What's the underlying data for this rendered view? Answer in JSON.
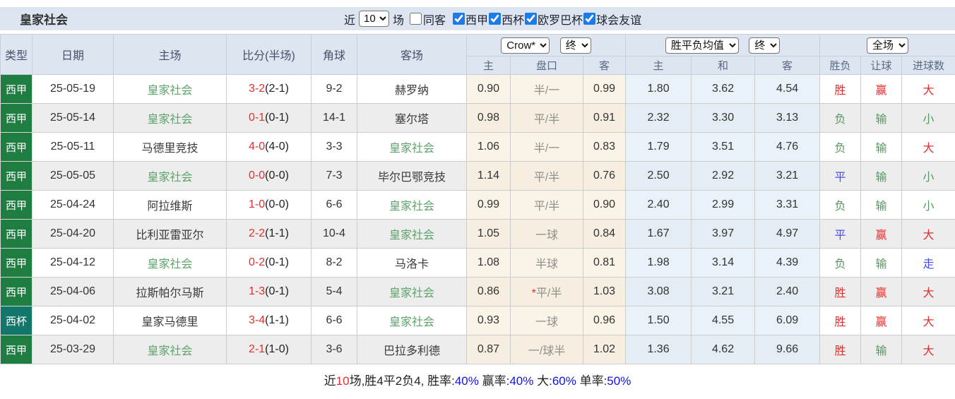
{
  "title": "皇家社会",
  "controls": {
    "recent_label": "近",
    "recent_count": "10",
    "matches_label": "场",
    "same_away": {
      "label": "同客",
      "checked": false
    },
    "filters": [
      {
        "label": "西甲",
        "checked": true
      },
      {
        "label": "西杯",
        "checked": true
      },
      {
        "label": "欧罗巴杯",
        "checked": true
      },
      {
        "label": "球会友谊",
        "checked": true
      }
    ]
  },
  "colors": {
    "league_badge_green": "#1f7d41",
    "cup_badge_teal": "#13766b",
    "team_highlight_green": "#5ea36c",
    "team_dark": "#3a3a3a",
    "result_red": "#e62e2e",
    "result_green": "#559a60",
    "result_blue": "#4a4af5",
    "header_bg": "#dce5f0"
  },
  "table": {
    "columns": [
      "类型",
      "日期",
      "主场",
      "比分(半场)",
      "角球",
      "客场"
    ],
    "odds_columns": [
      "主",
      "盘口",
      "客",
      "主",
      "和",
      "客",
      "胜负",
      "让球",
      "进球数"
    ],
    "selects": {
      "ah_company": "Crow*",
      "ah_time": "终",
      "eu_company": "胜平负均值",
      "eu_time": "终",
      "scope": "全场"
    },
    "rows": [
      {
        "type": "西甲",
        "type_bg": "#1f7d41",
        "date": "25-05-19",
        "home": "皇家社会",
        "home_color": "#5ea36c",
        "score": "3-2",
        "half": "(2-1)",
        "corner": "9-2",
        "away": "赫罗纳",
        "away_color": "#3a3a3a",
        "ah_home": "0.90",
        "ah_star": "",
        "ah_line": "半/一",
        "ah_away": "0.99",
        "eu_home": "1.80",
        "eu_draw": "3.62",
        "eu_away": "4.54",
        "wdl": "胜",
        "wdl_color": "#e62e2e",
        "ah_result": "赢",
        "ah_result_color": "#e62e2e",
        "ou": "大",
        "ou_color": "#e62e2e"
      },
      {
        "type": "西甲",
        "type_bg": "#1f7d41",
        "date": "25-05-14",
        "home": "皇家社会",
        "home_color": "#5ea36c",
        "score": "0-1",
        "half": "(0-1)",
        "corner": "14-1",
        "away": "塞尔塔",
        "away_color": "#3a3a3a",
        "ah_home": "0.98",
        "ah_star": "",
        "ah_line": "平/半",
        "ah_away": "0.91",
        "eu_home": "2.32",
        "eu_draw": "3.30",
        "eu_away": "3.13",
        "wdl": "负",
        "wdl_color": "#559a60",
        "ah_result": "输",
        "ah_result_color": "#559a60",
        "ou": "小",
        "ou_color": "#559a60"
      },
      {
        "type": "西甲",
        "type_bg": "#1f7d41",
        "date": "25-05-11",
        "home": "马德里竞技",
        "home_color": "#3a3a3a",
        "score": "4-0",
        "half": "(4-0)",
        "corner": "3-3",
        "away": "皇家社会",
        "away_color": "#5ea36c",
        "ah_home": "1.06",
        "ah_star": "",
        "ah_line": "半/一",
        "ah_away": "0.83",
        "eu_home": "1.79",
        "eu_draw": "3.51",
        "eu_away": "4.76",
        "wdl": "负",
        "wdl_color": "#559a60",
        "ah_result": "输",
        "ah_result_color": "#559a60",
        "ou": "大",
        "ou_color": "#e62e2e"
      },
      {
        "type": "西甲",
        "type_bg": "#1f7d41",
        "date": "25-05-05",
        "home": "皇家社会",
        "home_color": "#5ea36c",
        "score": "0-0",
        "half": "(0-0)",
        "corner": "7-3",
        "away": "毕尔巴鄂竞技",
        "away_color": "#3a3a3a",
        "ah_home": "1.14",
        "ah_star": "",
        "ah_line": "平/半",
        "ah_away": "0.76",
        "eu_home": "2.50",
        "eu_draw": "2.92",
        "eu_away": "3.21",
        "wdl": "平",
        "wdl_color": "#4a4af5",
        "ah_result": "输",
        "ah_result_color": "#559a60",
        "ou": "小",
        "ou_color": "#559a60"
      },
      {
        "type": "西甲",
        "type_bg": "#1f7d41",
        "date": "25-04-24",
        "home": "阿拉维斯",
        "home_color": "#3a3a3a",
        "score": "1-0",
        "half": "(0-0)",
        "corner": "6-6",
        "away": "皇家社会",
        "away_color": "#5ea36c",
        "ah_home": "0.99",
        "ah_star": "",
        "ah_line": "平/半",
        "ah_away": "0.90",
        "eu_home": "2.40",
        "eu_draw": "2.99",
        "eu_away": "3.31",
        "wdl": "负",
        "wdl_color": "#559a60",
        "ah_result": "输",
        "ah_result_color": "#559a60",
        "ou": "小",
        "ou_color": "#559a60"
      },
      {
        "type": "西甲",
        "type_bg": "#1f7d41",
        "date": "25-04-20",
        "home": "比利亚雷亚尔",
        "home_color": "#3a3a3a",
        "score": "2-2",
        "half": "(1-1)",
        "corner": "10-4",
        "away": "皇家社会",
        "away_color": "#5ea36c",
        "ah_home": "1.05",
        "ah_star": "",
        "ah_line": "一球",
        "ah_away": "0.84",
        "eu_home": "1.67",
        "eu_draw": "3.97",
        "eu_away": "4.97",
        "wdl": "平",
        "wdl_color": "#4a4af5",
        "ah_result": "赢",
        "ah_result_color": "#e62e2e",
        "ou": "大",
        "ou_color": "#e62e2e"
      },
      {
        "type": "西甲",
        "type_bg": "#1f7d41",
        "date": "25-04-12",
        "home": "皇家社会",
        "home_color": "#5ea36c",
        "score": "0-2",
        "half": "(0-1)",
        "corner": "8-2",
        "away": "马洛卡",
        "away_color": "#3a3a3a",
        "ah_home": "1.08",
        "ah_star": "",
        "ah_line": "半球",
        "ah_away": "0.81",
        "eu_home": "1.98",
        "eu_draw": "3.14",
        "eu_away": "4.39",
        "wdl": "负",
        "wdl_color": "#559a60",
        "ah_result": "输",
        "ah_result_color": "#559a60",
        "ou": "走",
        "ou_color": "#4a4af5"
      },
      {
        "type": "西甲",
        "type_bg": "#1f7d41",
        "date": "25-04-06",
        "home": "拉斯帕尔马斯",
        "home_color": "#3a3a3a",
        "score": "1-3",
        "half": "(0-1)",
        "corner": "5-4",
        "away": "皇家社会",
        "away_color": "#5ea36c",
        "ah_home": "0.86",
        "ah_star": "*",
        "ah_line": "平/半",
        "ah_away": "1.03",
        "eu_home": "3.08",
        "eu_draw": "3.21",
        "eu_away": "2.40",
        "wdl": "胜",
        "wdl_color": "#e62e2e",
        "ah_result": "赢",
        "ah_result_color": "#e62e2e",
        "ou": "大",
        "ou_color": "#e62e2e"
      },
      {
        "type": "西杯",
        "type_bg": "#13766b",
        "date": "25-04-02",
        "home": "皇家马德里",
        "home_color": "#3a3a3a",
        "score": "3-4",
        "half": "(1-1)",
        "corner": "6-6",
        "away": "皇家社会",
        "away_color": "#5ea36c",
        "ah_home": "0.93",
        "ah_star": "",
        "ah_line": "一球",
        "ah_away": "0.96",
        "eu_home": "1.50",
        "eu_draw": "4.55",
        "eu_away": "6.09",
        "wdl": "胜",
        "wdl_color": "#e62e2e",
        "ah_result": "赢",
        "ah_result_color": "#e62e2e",
        "ou": "大",
        "ou_color": "#e62e2e"
      },
      {
        "type": "西甲",
        "type_bg": "#1f7d41",
        "date": "25-03-29",
        "home": "皇家社会",
        "home_color": "#5ea36c",
        "score": "2-1",
        "half": "(1-0)",
        "corner": "3-6",
        "away": "巴拉多利德",
        "away_color": "#3a3a3a",
        "ah_home": "0.87",
        "ah_star": "",
        "ah_line": "一/球半",
        "ah_away": "1.02",
        "eu_home": "1.36",
        "eu_draw": "4.62",
        "eu_away": "9.66",
        "wdl": "胜",
        "wdl_color": "#e62e2e",
        "ah_result": "输",
        "ah_result_color": "#559a60",
        "ou": "大",
        "ou_color": "#e62e2e"
      }
    ]
  },
  "summary": {
    "parts": [
      {
        "text": "近",
        "color": "dark"
      },
      {
        "text": "10",
        "color": "red"
      },
      {
        "text": "场,胜4平2负4, 胜率:",
        "color": "dark"
      },
      {
        "text": "40%",
        "color": "blue"
      },
      {
        "text": " 赢率:",
        "color": "dark"
      },
      {
        "text": "40%",
        "color": "blue"
      },
      {
        "text": " 大:",
        "color": "dark"
      },
      {
        "text": "60%",
        "color": "blue"
      },
      {
        "text": " 单率:",
        "color": "dark"
      },
      {
        "text": "50%",
        "color": "blue"
      }
    ]
  }
}
